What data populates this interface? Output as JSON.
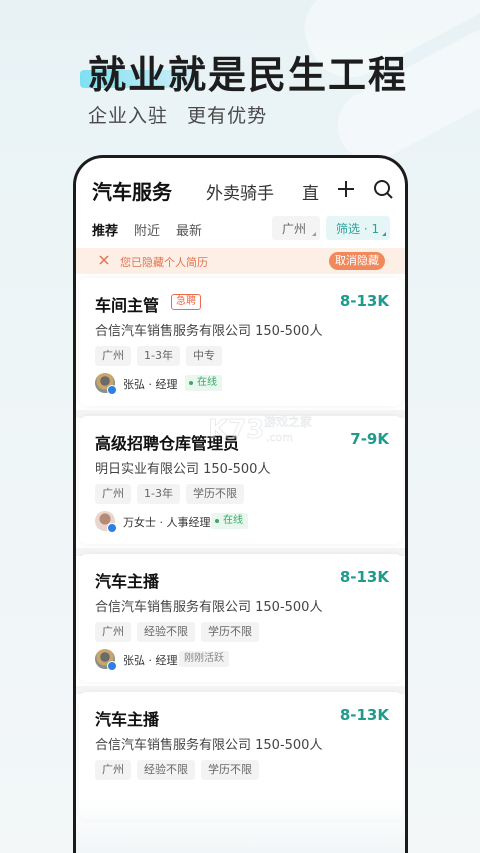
{
  "banner": {
    "headline": "就业就是民生工程",
    "subline_a": "企业入驻",
    "subline_b": "更有优势"
  },
  "tabs": {
    "main": "汽车服务",
    "second": "外卖骑手",
    "third": "直"
  },
  "filters": {
    "recommend": "推荐",
    "nearby": "附近",
    "latest": "最新",
    "city": "广州",
    "filter": "筛选 · 1"
  },
  "notice": {
    "text": "您已隐藏个人简历",
    "button": "取消隐藏"
  },
  "jobs": [
    {
      "title": "车间主管",
      "badge": "急聘",
      "salary": "8-13K",
      "company": "合信汽车销售服务有限公司  150-500人",
      "tags": [
        "广州",
        "1-3年",
        "中专"
      ],
      "recruiter": "张弘 · 经理",
      "status": "在线"
    },
    {
      "title": "高级招聘仓库管理员",
      "salary": "7-9K",
      "company": "明日实业有限公司  150-500人",
      "tags": [
        "广州",
        "1-3年",
        "学历不限"
      ],
      "recruiter": "万女士 · 人事经理",
      "status": "在线"
    },
    {
      "title": "汽车主播",
      "salary": "8-13K",
      "company": "合信汽车销售服务有限公司  150-500人",
      "tags": [
        "广州",
        "经验不限",
        "学历不限"
      ],
      "recruiter": "张弘 · 经理",
      "status": "刚刚活跃"
    },
    {
      "title": "汽车主播",
      "salary": "8-13K",
      "company": "合信汽车销售服务有限公司  150-500人",
      "tags": [
        "广州",
        "经验不限",
        "学历不限"
      ]
    }
  ],
  "watermark": {
    "brand": "K73",
    "line1": "游戏之家",
    "line2": ".com"
  },
  "colors": {
    "accent": "#1f9a8c",
    "urgent": "#ee6b4a",
    "notice_bg": "#fdeee6",
    "online": "#3aa86a"
  }
}
